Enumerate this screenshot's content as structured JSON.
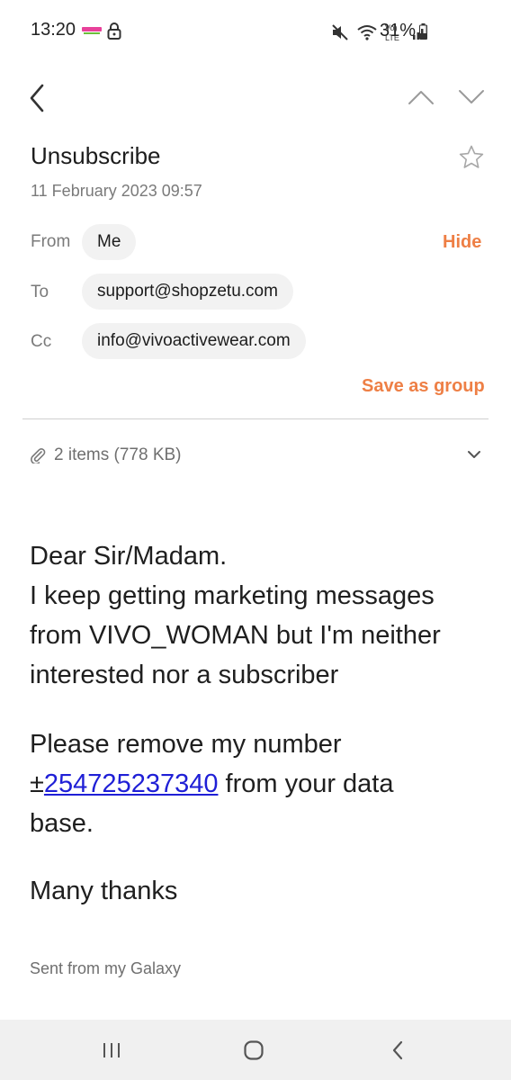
{
  "status_bar": {
    "time": "13:20",
    "battery_percent": "31%",
    "icons": [
      "app-notification-icon",
      "lock-icon",
      "mute-icon",
      "wifi-icon",
      "volte-icon",
      "signal-icon",
      "battery-icon"
    ]
  },
  "toolbar": {
    "back_icon": "chevron-left",
    "prev_icon": "chevron-up",
    "next_icon": "chevron-down"
  },
  "email": {
    "subject": "Unsubscribe",
    "date": "11 February 2023  09:57",
    "from_label": "From",
    "from_value": "Me",
    "hide_label": "Hide",
    "to_label": "To",
    "to_value": "support@shopzetu.com",
    "cc_label": "Cc",
    "cc_value": "info@vivoactivewear.com",
    "save_group_label": "Save as group",
    "attachments_summary": "2 items (778 KB)",
    "body": {
      "p1_lines": [
        "Dear Sir/Madam.",
        "I keep getting marketing messages",
        "from VIVO_WOMAN but I'm neither",
        "interested nor a subscriber"
      ],
      "p2_line1": "Please remove my number",
      "p2_prefix": "±",
      "phone": "254725237340",
      "p2_suffix": " from your data",
      "p2_line3": "base.",
      "p3": "Many thanks"
    },
    "signature": "Sent from my Galaxy"
  },
  "colors": {
    "accent": "#ee7f45",
    "link": "#1f1fd6",
    "chip_bg": "#f2f2f2",
    "nav_bg": "#f0f0f0"
  }
}
